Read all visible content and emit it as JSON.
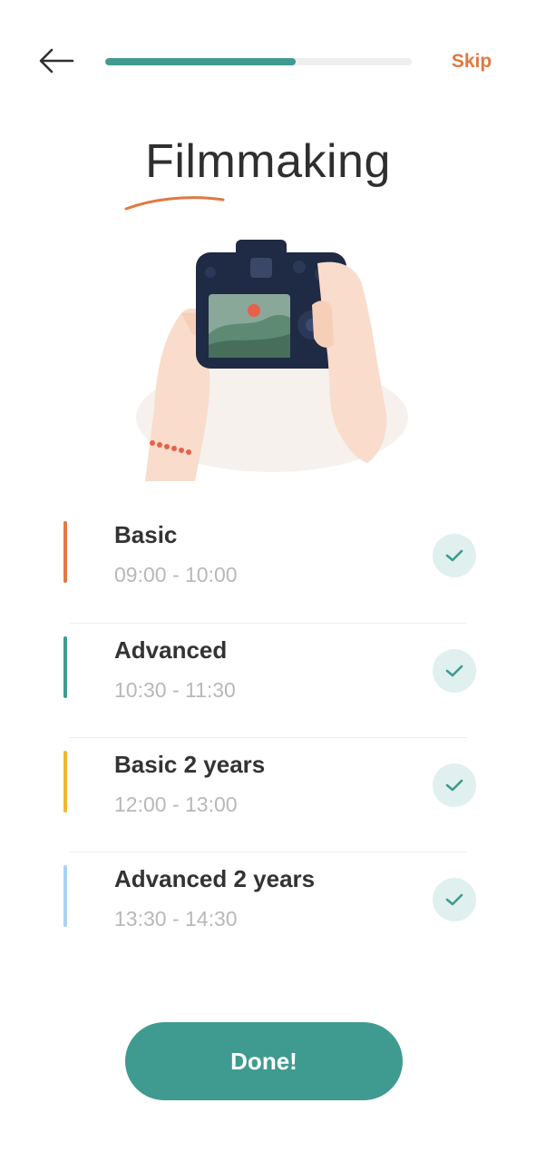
{
  "header": {
    "back_icon": "arrow-left-icon",
    "progress_percent": 62,
    "skip_label": "Skip"
  },
  "title": "Filmmaking",
  "illustration_icon": "camera-hands-illustration",
  "courses": [
    {
      "name": "Basic",
      "time": "09:00 - 10:00",
      "color": "#e07a45",
      "checked": true
    },
    {
      "name": "Advanced",
      "time": "10:30 - 11:30",
      "color": "#3f9b90",
      "checked": true
    },
    {
      "name": "Basic 2 years",
      "time": "12:00 - 13:00",
      "color": "#f2b731",
      "checked": true
    },
    {
      "name": "Advanced 2 years",
      "time": "13:30 - 14:30",
      "color": "#a9d2f2",
      "checked": true
    }
  ],
  "done_label": "Done!",
  "colors": {
    "accent": "#3f9b90",
    "skip": "#e0793f",
    "check_bg": "#dff0ee"
  }
}
